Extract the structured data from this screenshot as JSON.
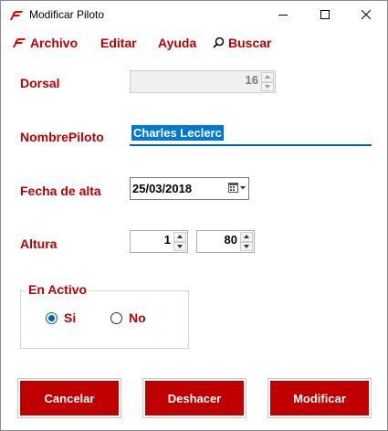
{
  "window": {
    "title": "Modificar Piloto"
  },
  "menu": {
    "archivo": "Archivo",
    "editar": "Editar",
    "ayuda": "Ayuda",
    "buscar": "Buscar"
  },
  "form": {
    "dorsal": {
      "label": "Dorsal",
      "value": "16",
      "enabled": false
    },
    "nombre": {
      "label": "NombrePiloto",
      "value": "Charles Leclerc"
    },
    "fecha": {
      "label": "Fecha de alta",
      "value": "25/03/2018"
    },
    "altura": {
      "label": "Altura",
      "metros": "1",
      "centimetros": "80"
    }
  },
  "activo": {
    "title": "En Activo",
    "options": [
      {
        "label": "Si",
        "checked": true
      },
      {
        "label": "No",
        "checked": false
      }
    ]
  },
  "buttons": {
    "cancelar": "Cancelar",
    "deshacer": "Deshacer",
    "modificar": "Modificar"
  },
  "colors": {
    "accent": "#c00000",
    "selection": "#0078d7",
    "radio": "#0063b1"
  },
  "icons": {
    "app": "f1-logo-icon",
    "archivo": "f1-logo-icon",
    "buscar": "search-icon",
    "fecha": "calendar-icon"
  }
}
